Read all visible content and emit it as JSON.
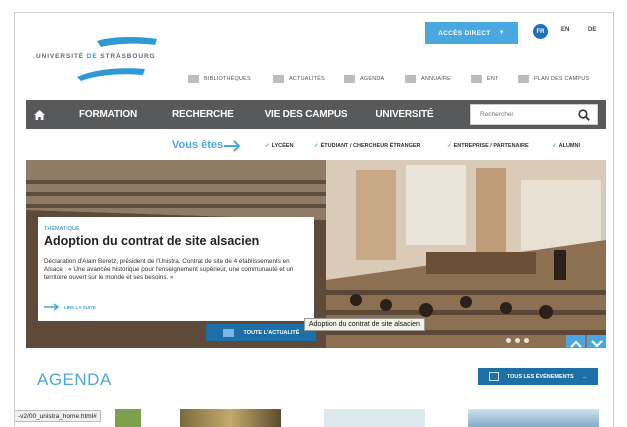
{
  "logo": {
    "text_prefix": "UNIVERSITÉ ",
    "text_de": "DE",
    "text_suffix": " STRASBOURG"
  },
  "header": {
    "acces_direct": "ACCÈS DIRECT",
    "languages": [
      "FR",
      "EN",
      "DE"
    ],
    "quick_links": [
      {
        "label": "BIBLIOTHÈQUES",
        "icon": "books-icon"
      },
      {
        "label": "ACTUALITÉS",
        "icon": "news-icon"
      },
      {
        "label": "AGENDA",
        "icon": "calendar-icon"
      },
      {
        "label": "ANNUAIRE",
        "icon": "directory-icon"
      },
      {
        "label": "ENT",
        "icon": "screen-icon"
      },
      {
        "label": "PLAN DES CAMPUS",
        "icon": "map-icon"
      }
    ]
  },
  "nav": {
    "items": [
      "FORMATION",
      "RECHERCHE",
      "VIE DES CAMPUS",
      "UNIVERSITÉ"
    ],
    "search_placeholder": "Rechercher"
  },
  "audience": {
    "label": "Vous êtes",
    "items": [
      "LYCÉEN",
      "ÉTUDIANT / CHERCHEUR ÉTRANGER",
      "ENTREPRISE / PARTENAIRE",
      "ALUMNI"
    ]
  },
  "hero": {
    "tag": "THÉMATIQUE",
    "title": "Adoption du contrat de site alsacien",
    "text": "Déclaration d'Alain Beretz, président de l'Unistra. Contrat de site de 4 établissements en Alsace : « Une avancée historique pour l'enseignement supérieur, une communauté et un territoire ouvert sur le monde et ses besoins. »",
    "more": "LIRE LA SUITE",
    "all_news": "TOUTE L'ACTUALITÉ",
    "tooltip": "Adoption du contrat de site alsacien"
  },
  "agenda": {
    "title": "AGENDA",
    "all_events": "TOUS LES ÉVÉNEMENTS"
  },
  "status_bar": {
    "url": "-v2/00_unistra_home.html#"
  },
  "colors": {
    "accent": "#4aa8e0",
    "dark_blue": "#1d6fa8",
    "nav_bg": "#58595b"
  }
}
